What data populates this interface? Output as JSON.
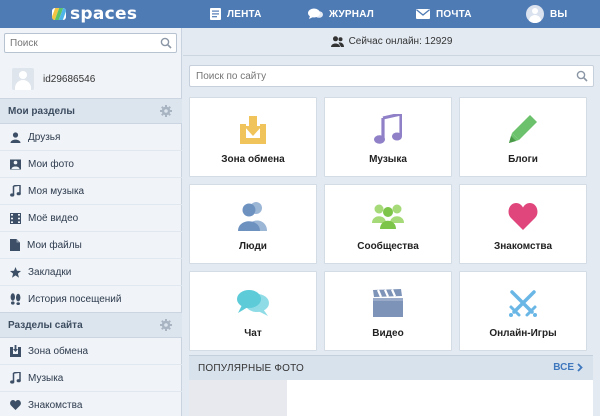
{
  "header": {
    "logo_text": "spaces",
    "nav": [
      {
        "label": "ЛЕНТА",
        "icon": "feed-icon"
      },
      {
        "label": "ЖУРНАЛ",
        "icon": "chat-bubbles-icon"
      },
      {
        "label": "ПОЧТА",
        "icon": "envelope-icon"
      },
      {
        "label": "ВЫ",
        "icon": "user-avatar-icon"
      }
    ]
  },
  "sidebar": {
    "search_placeholder": "Поиск",
    "profile_name": "id29686546",
    "my_sections_title": "Мои разделы",
    "my_sections": [
      {
        "label": "Друзья",
        "icon": "friends-icon"
      },
      {
        "label": "Мои фото",
        "icon": "photo-icon"
      },
      {
        "label": "Моя музыка",
        "icon": "music-note-icon"
      },
      {
        "label": "Моё видео",
        "icon": "video-icon"
      },
      {
        "label": "Мои файлы",
        "icon": "file-icon"
      },
      {
        "label": "Закладки",
        "icon": "star-icon"
      },
      {
        "label": "История посещений",
        "icon": "footprints-icon"
      }
    ],
    "site_sections_title": "Разделы сайта",
    "site_sections": [
      {
        "label": "Зона обмена",
        "icon": "exchange-icon"
      },
      {
        "label": "Музыка",
        "icon": "music-note-icon"
      },
      {
        "label": "Знакомства",
        "icon": "heart-icon"
      }
    ]
  },
  "main": {
    "online_text": "Сейчас онлайн: 12929",
    "search_placeholder": "Поиск по сайту",
    "tiles": [
      {
        "label": "Зона обмена",
        "icon": "download-tray-icon",
        "color": "#f0c45a"
      },
      {
        "label": "Музыка",
        "icon": "music-note-icon",
        "color": "#8f80c8"
      },
      {
        "label": "Блоги",
        "icon": "pen-icon",
        "color": "#6cc26c"
      },
      {
        "label": "Люди",
        "icon": "people-icon",
        "color": "#7ea1c9"
      },
      {
        "label": "Сообщества",
        "icon": "community-icon",
        "color": "#8fcf5e"
      },
      {
        "label": "Знакомства",
        "icon": "heart-icon",
        "color": "#e0457b"
      },
      {
        "label": "Чат",
        "icon": "chat-icon",
        "color": "#5ecbd8"
      },
      {
        "label": "Видео",
        "icon": "clapperboard-icon",
        "color": "#7e93b8"
      },
      {
        "label": "Онлайн-Игры",
        "icon": "crossed-swords-icon",
        "color": "#6ab7e6"
      }
    ],
    "popular": {
      "title": "ПОПУЛЯРНЫЕ ФОТО",
      "all_label": "ВСЕ"
    }
  },
  "colors": {
    "header_bg": "#4f7bb5",
    "accent_link": "#3f78bd"
  }
}
